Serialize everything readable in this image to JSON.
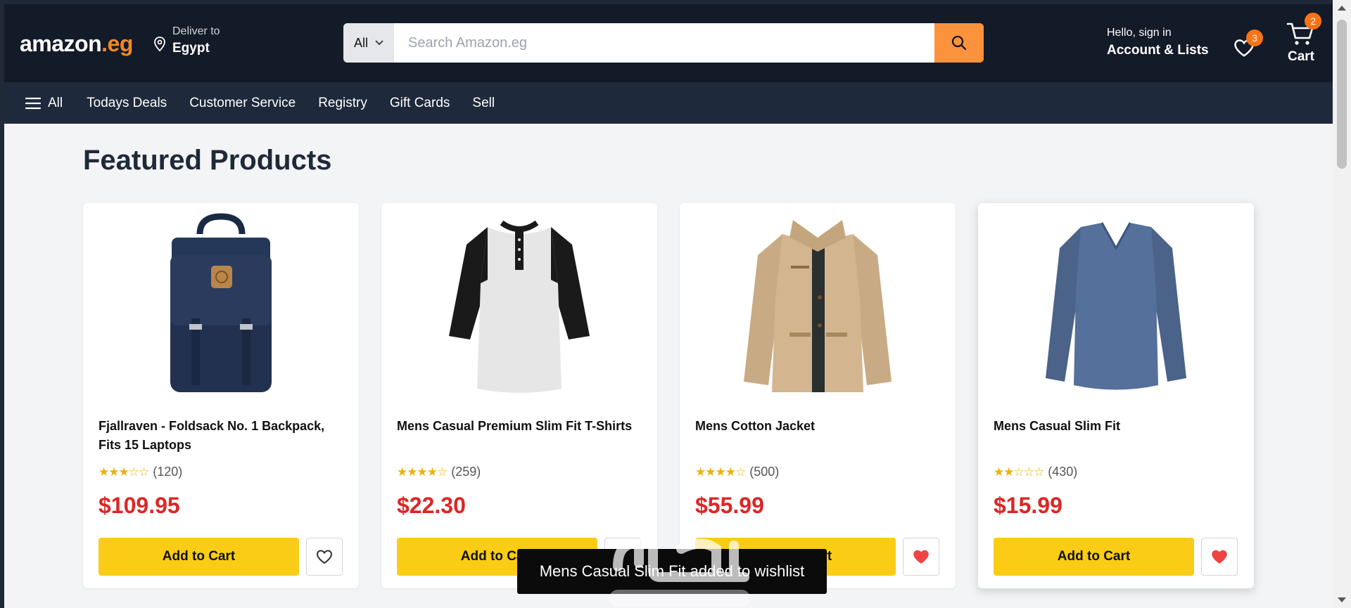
{
  "header": {
    "logo_main": "amazon",
    "logo_suffix": ".eg",
    "deliver_label": "Deliver to",
    "deliver_country": "Egypt",
    "search": {
      "category": "All",
      "placeholder": "Search Amazon.eg"
    },
    "account_greeting": "Hello, sign in",
    "account_label": "Account & Lists",
    "wishlist_count": "3",
    "cart_count": "2",
    "cart_label": "Cart"
  },
  "nav": {
    "all_label": "All",
    "items": [
      "Todays Deals",
      "Customer Service",
      "Registry",
      "Gift Cards",
      "Sell"
    ]
  },
  "main": {
    "heading": "Featured Products",
    "products": [
      {
        "title": "Fjallraven - Foldsack No. 1 Backpack, Fits 15 Laptops",
        "rating": 3,
        "reviews": "(120)",
        "stars": "★★★☆☆",
        "price": "$109.95",
        "add_label": "Add to Cart",
        "wishlisted": false,
        "image": "backpack"
      },
      {
        "title": "Mens Casual Premium Slim Fit T-Shirts",
        "rating": 4,
        "reviews": "(259)",
        "stars": "★★★★☆",
        "price": "$22.30",
        "add_label": "Add to Cart",
        "wishlisted": false,
        "image": "raglan-tshirt"
      },
      {
        "title": "Mens Cotton Jacket",
        "rating": 4,
        "reviews": "(500)",
        "stars": "★★★★☆",
        "price": "$55.99",
        "add_label": "Add to Cart",
        "wishlisted": true,
        "image": "jacket"
      },
      {
        "title": "Mens Casual Slim Fit",
        "rating": 2,
        "reviews": "(430)",
        "stars": "★★☆☆☆",
        "price": "$15.99",
        "add_label": "Add to Cart",
        "wishlisted": true,
        "image": "longsleeve"
      }
    ]
  },
  "toast": {
    "message": "Mens Casual Slim Fit added to wishlist"
  },
  "colors": {
    "header_bg": "#131a28",
    "nav_bg": "#1e293b",
    "accent_orange": "#fb923c",
    "button_yellow": "#facc15",
    "price_red": "#dc2626",
    "star_gold": "#eab308"
  },
  "icons": [
    "location-pin-icon",
    "chevron-down-icon",
    "search-icon",
    "heart-icon",
    "cart-icon",
    "hamburger-icon"
  ]
}
